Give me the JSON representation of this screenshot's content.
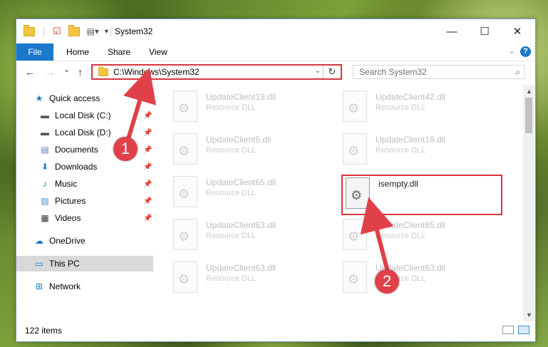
{
  "window": {
    "title": "System32",
    "controls": {
      "minimize": "—",
      "maximize": "☐",
      "close": "✕"
    }
  },
  "ribbon": {
    "tabs": [
      {
        "label": "File"
      },
      {
        "label": "Home"
      },
      {
        "label": "Share"
      },
      {
        "label": "View"
      }
    ],
    "help": "?"
  },
  "navbar": {
    "back": "←",
    "forward": "→",
    "recent": "⌄",
    "up": "↑",
    "address": "C:\\Windows\\System32",
    "refresh": "↻",
    "search_placeholder": "Search System32",
    "search_icon": "⌕"
  },
  "sidebar": {
    "items": [
      {
        "label": "Quick access",
        "icon": "star-icon",
        "glyph": "★"
      },
      {
        "label": "Local Disk (C:)",
        "icon": "drive-icon",
        "glyph": "▬"
      },
      {
        "label": "Local Disk (D:)",
        "icon": "drive-icon",
        "glyph": "▬"
      },
      {
        "label": "Documents",
        "icon": "documents-icon",
        "glyph": "▤"
      },
      {
        "label": "Downloads",
        "icon": "download-icon",
        "glyph": "⬇"
      },
      {
        "label": "Music",
        "icon": "music-icon",
        "glyph": "♪"
      },
      {
        "label": "Pictures",
        "icon": "pictures-icon",
        "glyph": "▨"
      },
      {
        "label": "Videos",
        "icon": "videos-icon",
        "glyph": "▦"
      },
      {
        "label": "OneDrive",
        "icon": "cloud-icon",
        "glyph": "☁"
      },
      {
        "label": "This PC",
        "icon": "computer-icon",
        "glyph": "▭"
      },
      {
        "label": "Network",
        "icon": "network-icon",
        "glyph": "⊞"
      }
    ],
    "pin": "📌"
  },
  "files": [
    {
      "name": "UpdateClient19.dll",
      "type": "Resource DLL"
    },
    {
      "name": "UpdateClient42.dll",
      "type": "Resource DLL"
    },
    {
      "name": "UpdateClient5.dll",
      "type": "Resource DLL"
    },
    {
      "name": "UpdateClient19.dll",
      "type": "Resource DLL"
    },
    {
      "name": "UpdateClient65.dll",
      "type": "Resource DLL"
    },
    {
      "name": "isempty.dll",
      "type": ""
    },
    {
      "name": "UpdateClient63.dll",
      "type": "Resource DLL"
    },
    {
      "name": "UpdateClient65.dll",
      "type": "Resource DLL"
    },
    {
      "name": "UpdateClient63.dll",
      "type": "Resource DLL"
    },
    {
      "name": "UpdateClient63.dll",
      "type": "Resource DLL"
    }
  ],
  "status": {
    "count": "122 items"
  },
  "annotations": {
    "badge1": "1",
    "badge2": "2",
    "accent": "#e04048"
  }
}
